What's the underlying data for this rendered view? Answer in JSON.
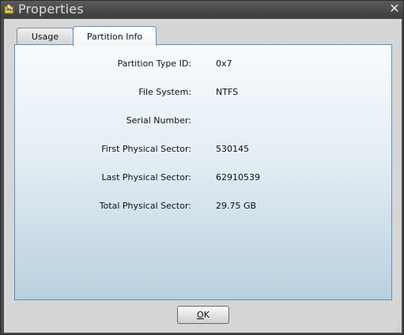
{
  "window": {
    "title": "Properties",
    "close_glyph": "✕"
  },
  "tabs": [
    {
      "label": "Usage",
      "selected": false
    },
    {
      "label": "Partition Info",
      "selected": true
    }
  ],
  "partition_info": [
    {
      "label": "Partition Type ID:",
      "value": "0x7"
    },
    {
      "label": "File System:",
      "value": "NTFS"
    },
    {
      "label": "Serial Number:",
      "value": ""
    },
    {
      "label": "First Physical Sector:",
      "value": "530145"
    },
    {
      "label": "Last Physical Sector:",
      "value": "62910539"
    },
    {
      "label": "Total Physical Sector:",
      "value": "29.75 GB"
    }
  ],
  "buttons": {
    "ok_mnemonic": "O",
    "ok_rest": "K"
  },
  "colors": {
    "tab_accent": "#5a8fc0",
    "titlebar": "#4a4a4a"
  },
  "icons": {
    "title": "app-icon",
    "close": "close-icon",
    "grip": "resize-grip-icon"
  }
}
